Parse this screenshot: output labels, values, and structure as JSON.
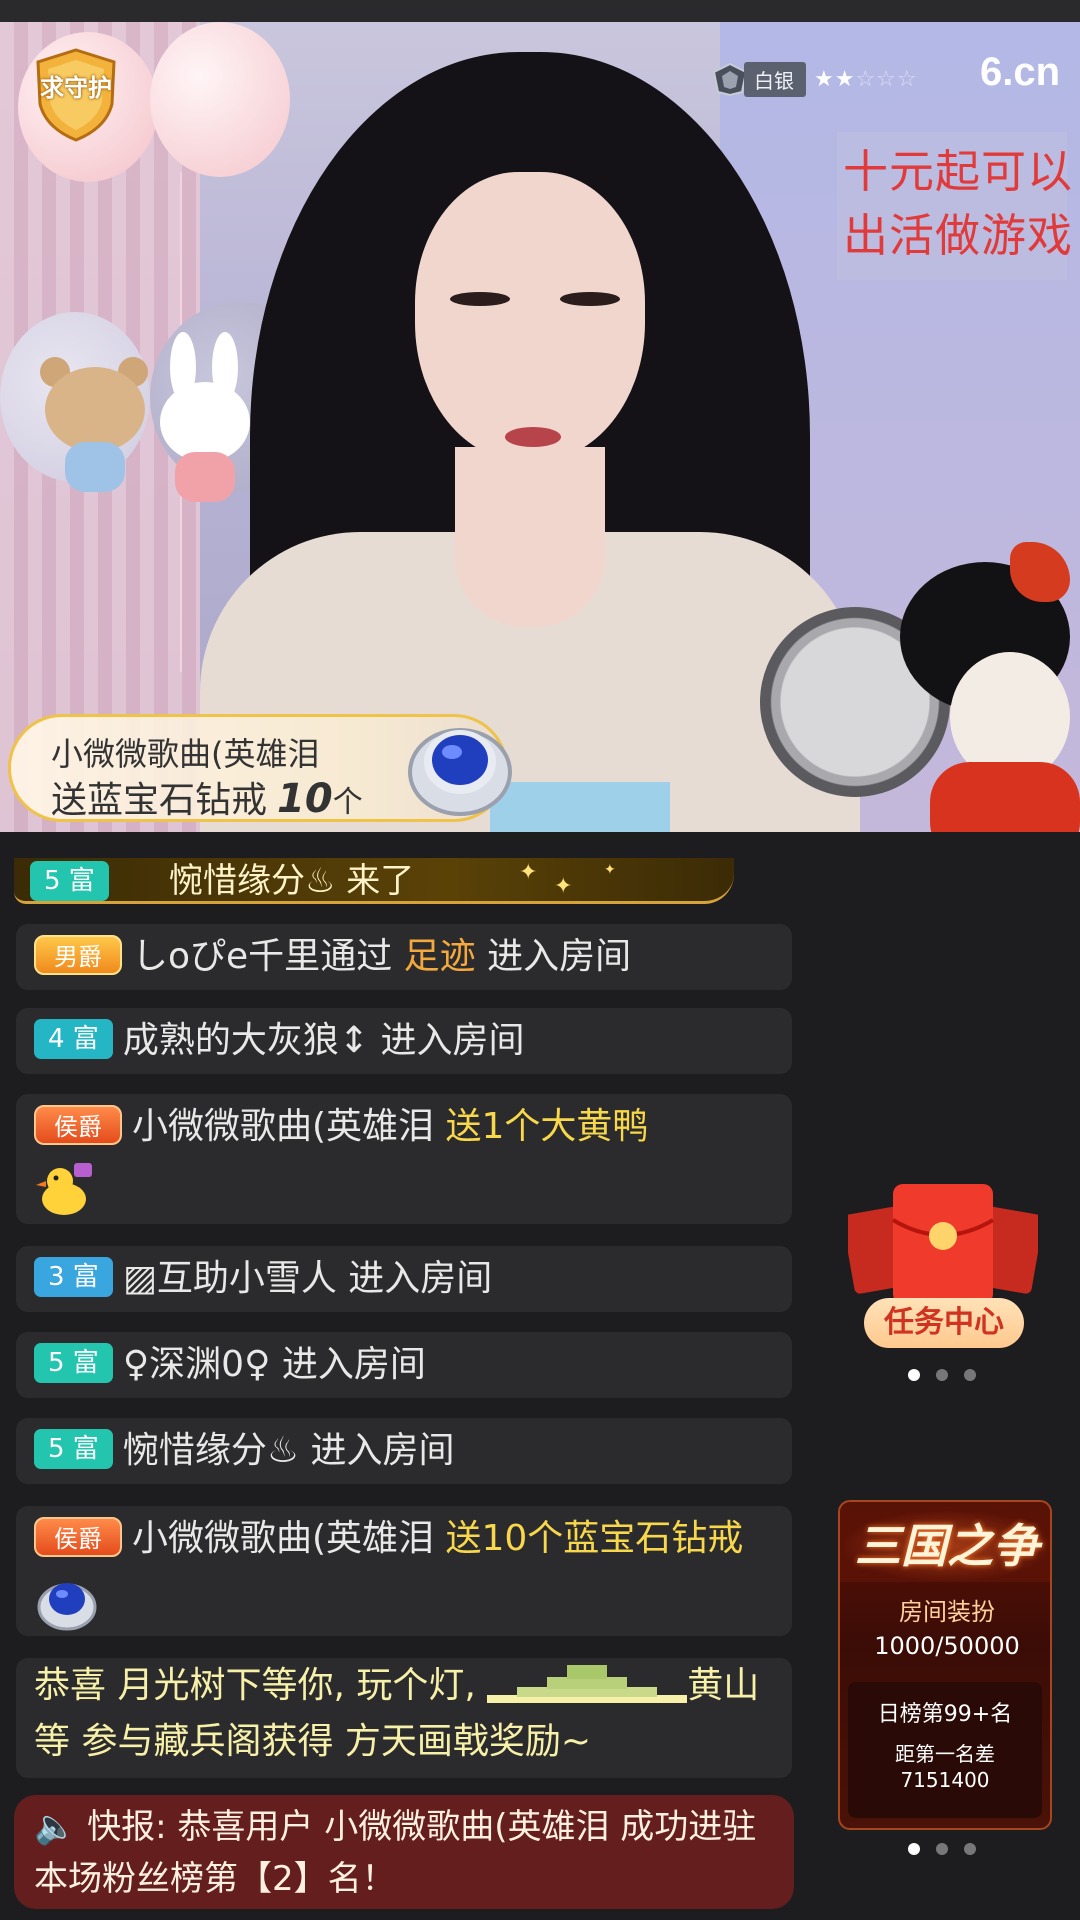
{
  "stream": {
    "guard_logo_text": "求守护",
    "rank_label": "白银",
    "rank_stars_on": "★★",
    "rank_stars_off": "☆☆☆",
    "brand": "6.cn",
    "sign_line1": "十元起可以",
    "sign_line2": "出活做游戏",
    "gift_banner": {
      "sender": "小微微歌曲(英雄泪",
      "verb": "送",
      "gift": "蓝宝石钻戒",
      "count": "10",
      "unit": "个"
    }
  },
  "chat": {
    "first": {
      "badge": "5 富",
      "text": "惋惜缘分♨ 来了"
    },
    "msg1": {
      "badge": "男爵",
      "user": "しoぴe千里",
      "via": "通过",
      "source": "足迹",
      "action": "进入房间"
    },
    "msg2": {
      "badge": "4 富",
      "user": "成熟的大灰狼↕",
      "action": "进入房间"
    },
    "msg3": {
      "badge": "侯爵",
      "user": "小微微歌曲(英雄泪",
      "gift_text": "送1个大黄鸭"
    },
    "msg4": {
      "badge": "3 富",
      "user": "▨互助小雪人",
      "action": "进入房间"
    },
    "msg5": {
      "badge": "5 富",
      "user": "♀深渊0♀",
      "action": "进入房间"
    },
    "msg6": {
      "badge": "5 富",
      "user": "惋惜缘分♨",
      "action": "进入房间"
    },
    "msg7": {
      "badge": "侯爵",
      "user": "小微微歌曲(英雄泪",
      "gift_text": "送10个蓝宝石钻戒"
    },
    "fortune": {
      "prefix": "恭喜 月光树下等你, 玩个灯,",
      "suffix": "黄山等 参与藏兵阁获得 方天画戟奖励~"
    },
    "flash": {
      "text": "快报: 恭喜用户 小微微歌曲(英雄泪 成功进驻本场粉丝榜第【2】名！"
    }
  },
  "widgets": {
    "task_center": "任务中心",
    "promo": {
      "title": "三国之争",
      "subtitle": "房间装扮",
      "progress": "1000/50000",
      "rank": "日榜第99+名",
      "gap_label": "距第一名差",
      "gap_value": "7151400"
    }
  }
}
